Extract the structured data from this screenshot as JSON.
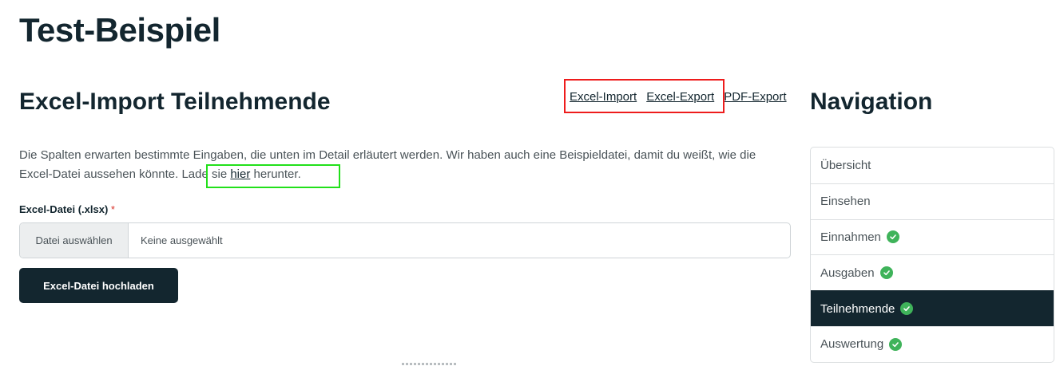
{
  "page": {
    "title": "Test-Beispiel"
  },
  "section": {
    "title": "Excel-Import Teilnehmende"
  },
  "top_links": [
    "Excel-Import",
    "Excel-Export",
    "PDF-Export"
  ],
  "description": {
    "text_before": "Die Spalten erwarten bestimmte Eingaben, die unten im Detail erläutert werden. Wir haben auch eine Beispieldatei, damit du weißt, wie die Excel-Datei aussehen könnte. Lade sie ",
    "link": "hier",
    "text_after": " herunter."
  },
  "file_field": {
    "label": "Excel-Datei (.xlsx)",
    "required_mark": "*",
    "button": "Datei auswählen",
    "status": "Keine ausgewählt"
  },
  "upload_button": "Excel-Datei hochladen",
  "navigation": {
    "title": "Navigation",
    "items": [
      {
        "label": "Übersicht",
        "done": false,
        "active": false
      },
      {
        "label": "Einsehen",
        "done": false,
        "active": false
      },
      {
        "label": "Einnahmen",
        "done": true,
        "active": false
      },
      {
        "label": "Ausgaben",
        "done": true,
        "active": false
      },
      {
        "label": "Teilnehmende",
        "done": true,
        "active": true
      },
      {
        "label": "Auswertung",
        "done": true,
        "active": false
      }
    ]
  },
  "colors": {
    "primary": "#13262f",
    "check": "#3fb35a",
    "highlight_red": "#ee1c1c",
    "highlight_green": "#22e01a",
    "required": "#d9342b"
  },
  "icons": {
    "done": "check-circle-icon"
  }
}
